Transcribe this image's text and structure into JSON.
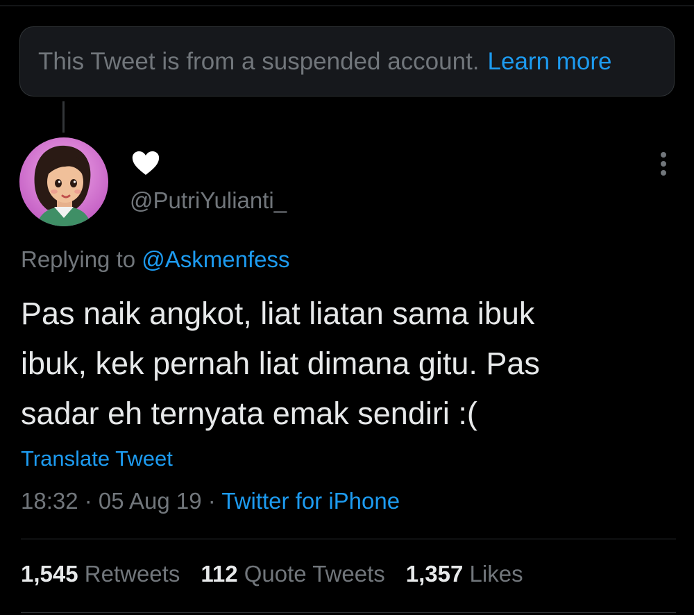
{
  "banner": {
    "text": "This Tweet is from a suspended account.",
    "link": "Learn more"
  },
  "author": {
    "display_name_icon": "white-heart-icon",
    "handle": "@PutriYulianti_",
    "avatar": "cartoon-girl-avatar"
  },
  "more_menu_icon": "vertical-ellipsis-icon",
  "reply": {
    "label": "Replying to",
    "handle": "@Askmenfess"
  },
  "tweet": {
    "lines": [
      "Pas naik angkot, liat liatan sama ibuk",
      "ibuk, kek pernah liat dimana gitu. Pas",
      "sadar eh ternyata emak sendiri :("
    ]
  },
  "translate_label": "Translate Tweet",
  "meta": {
    "time": "18:32",
    "separator": " · ",
    "date": "05 Aug 19",
    "source": "Twitter for iPhone"
  },
  "stats": {
    "retweets": {
      "count": "1,545",
      "label": "Retweets"
    },
    "quotes": {
      "count": "112",
      "label": "Quote Tweets"
    },
    "likes": {
      "count": "1,357",
      "label": "Likes"
    }
  },
  "colors": {
    "background": "#000000",
    "primary_text": "#e7e9ea",
    "secondary_text": "#71767b",
    "accent": "#1d9bf0",
    "border": "#2f3336"
  }
}
